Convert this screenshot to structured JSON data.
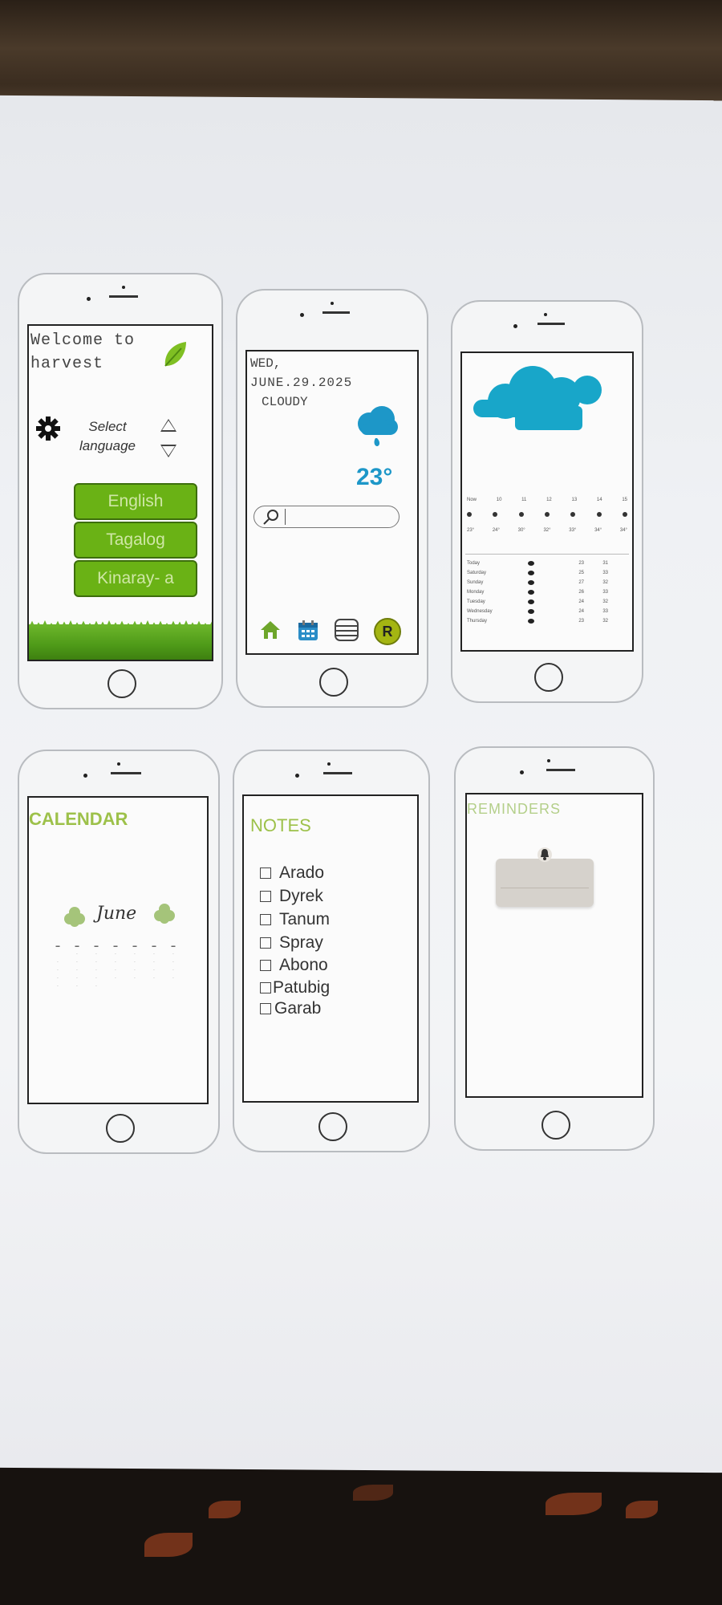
{
  "screens": {
    "welcome": {
      "title": "Welcome to harvest",
      "select_label": "Select language",
      "languages": [
        "English",
        "Tagalog",
        "Kinaray- a"
      ]
    },
    "weather": {
      "day": "WED,",
      "date": "JUNE.29.2025",
      "condition": "CLOUDY",
      "temperature": "23°",
      "nav_icons": [
        "home-icon",
        "calendar-icon",
        "list-icon",
        "profile-icon"
      ],
      "profile_letter": "R"
    },
    "forecast": {
      "rows": 7
    },
    "calendar": {
      "title": "CALENDAR",
      "month": "June"
    },
    "notes": {
      "title": "NOTES",
      "items": [
        "Arado",
        "Dyrek",
        "Tanum",
        "Spray",
        "Abono",
        "Patubig",
        "Garab"
      ]
    },
    "reminders": {
      "title": "REMINDERS"
    }
  },
  "colors": {
    "accent_green": "#6ab215",
    "title_green": "#9dc14a",
    "cloud_blue": "#18a6c9"
  }
}
